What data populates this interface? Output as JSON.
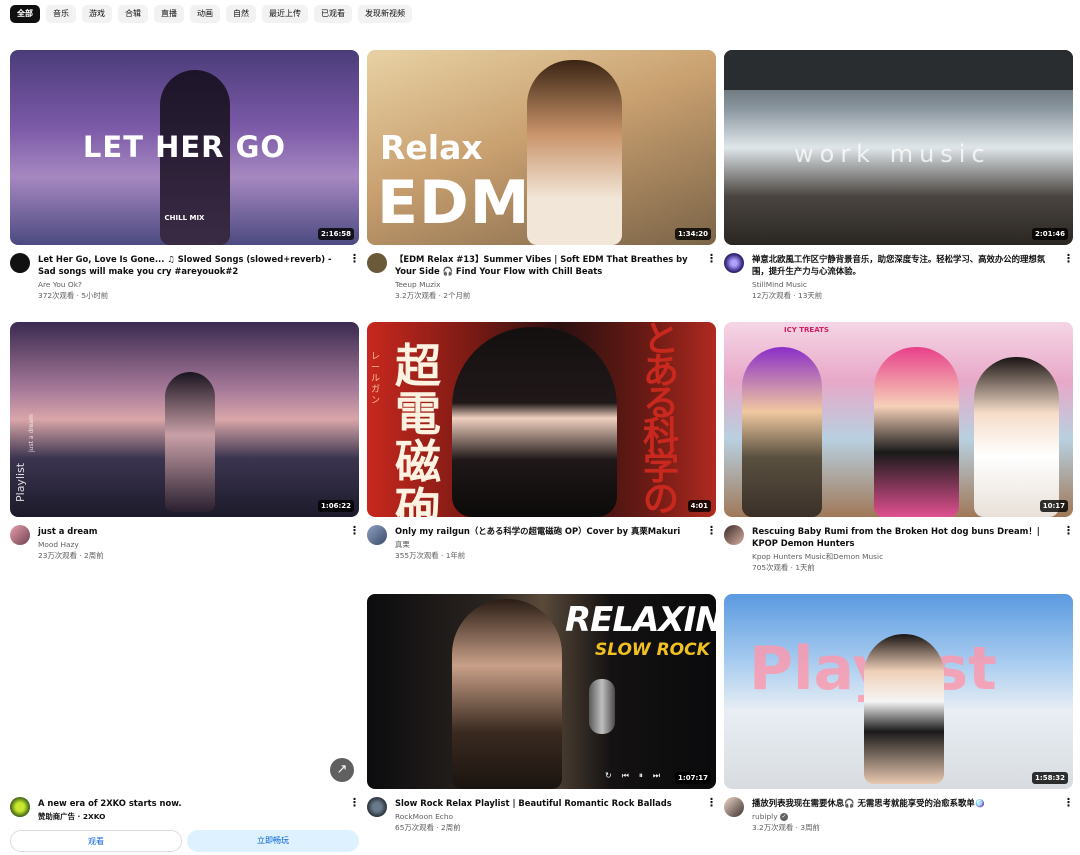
{
  "chips": [
    "全部",
    "音乐",
    "游戏",
    "合辑",
    "直播",
    "动画",
    "自然",
    "最近上传",
    "已观看",
    "发现新视频"
  ],
  "videos": [
    {
      "title": "Let Her Go, Love Is Gone... ♫ Slowed Songs (slowed+reverb) - Sad songs will make you cry #areyouok#2",
      "channel": "Are You Ok?",
      "stats": "372次观看 · 5小时前",
      "duration": "2:16:58",
      "thumb_text": "LET HER GO",
      "thumb_sub": "CHILL MIX"
    },
    {
      "title": "【EDM Relax #13】Summer Vibes | Soft EDM That Breathes by Your Side 🎧 Find Your Flow with Chill Beats",
      "channel": "Teeup Muzix",
      "stats": "3.2万次观看 · 2个月前",
      "duration": "1:34:20",
      "thumb_text_1": "Relax",
      "thumb_text_2": "EDM"
    },
    {
      "title": "禅意北欧風工作区宁静背景音乐，助您深度专注。轻松学习、高效办公的理想氛围，提升生产力与心流体验。",
      "channel": "StillMind Music",
      "stats": "12万次观看 · 13天前",
      "duration": "2:01:46",
      "thumb_text": "work music"
    },
    {
      "title": "just a dream",
      "channel": "Mood Hazy",
      "stats": "23万次观看 · 2周前",
      "duration": "1:06:22",
      "thumb_text": "Playlist",
      "thumb_sub": "just a dream"
    },
    {
      "title": "Only my railgun（とある科学の超電磁砲 OP）Cover by 真栗Makuri",
      "channel": "真栗",
      "stats": "355万次观看 · 1年前",
      "duration": "4:01",
      "thumb_text_1": "超電磁砲",
      "thumb_text_2": "とある科学の",
      "thumb_sub": "レールガン"
    },
    {
      "title": "Rescuing Baby Rumi from the Broken Hot dog buns Dream！| KPOP Demon Hunters",
      "channel": "Kpop Hunters Music和Demon Music",
      "stats": "705次观看 · 1天前",
      "duration": "10:17",
      "thumb_sub": "ICY TREATS"
    },
    {
      "title": "Slow Rock Relax Playlist | Beautiful Romantic Rock Ballads",
      "channel": "RockMoon Echo",
      "stats": "65万次观看 · 2周前",
      "duration": "1:07:17",
      "thumb_text_1": "RELAXING",
      "thumb_text_2": "SLOW ROCK"
    },
    {
      "title": "播放列表我现在需要休息🎧 无需思考就能享受的治愈系歌单🪩",
      "channel": "rubiply",
      "stats": "3.2万次观看 · 3周前",
      "duration": "1:58:32",
      "thumb_text": "Playlist"
    }
  ],
  "ad": {
    "title": "A new era of 2XKO starts now.",
    "sponsor": "赞助商广告 · 2XKO",
    "watch_label": "观看",
    "play_label": "立即畅玩"
  },
  "colors": {
    "accent": "#065fd4",
    "text": "#0f0f0f",
    "secondary": "#606060"
  }
}
